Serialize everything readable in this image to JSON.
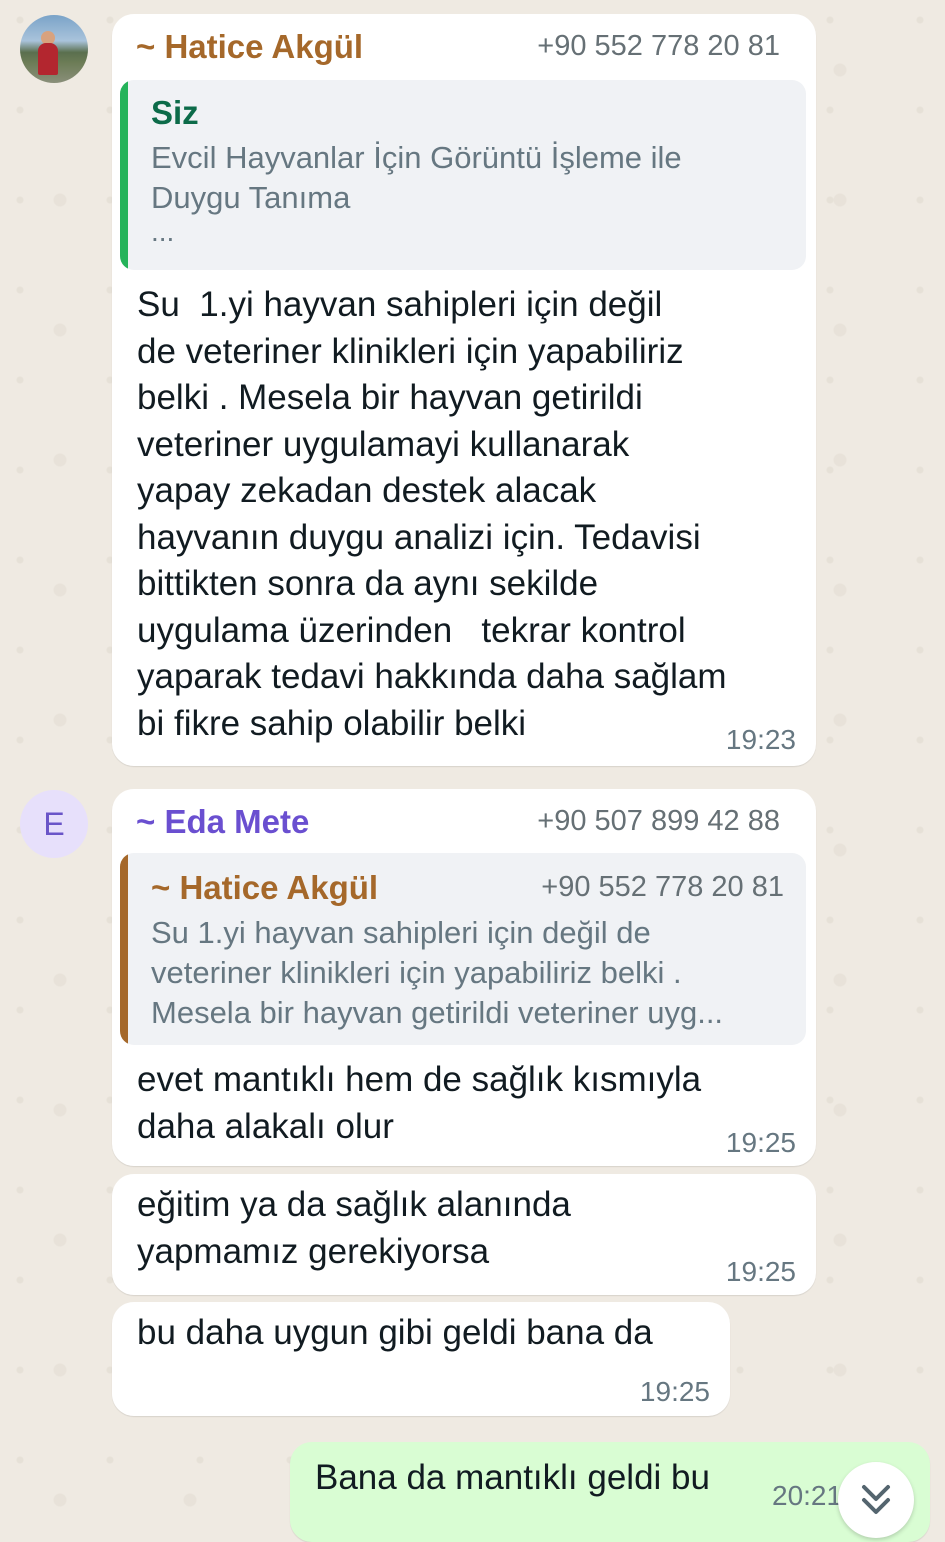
{
  "messages": [
    {
      "sender": "~ Hatice Akgül",
      "phone": "+90 552 778 20 81",
      "quote": {
        "author": "Siz",
        "lines": [
          "Evcil Hayvanlar İçin Görüntü İşleme ile",
          "Duygu Tanıma",
          "..."
        ]
      },
      "text": "Su  1.yi hayvan sahipleri için değil\nde veteriner klinikleri için yapabiliriz\nbelki . Mesela bir hayvan getirildi\nveteriner uygulamayi kullanarak\nyapay zekadan destek alacak\nhayvanın duygu analizi için. Tedavisi\nbittikten sonra da aynı sekilde\nuygulama üzerinden   tekrar kontrol\nyaparak tedavi hakkında daha sağlam\nbi fikre sahip olabilir belki",
      "time": "19:23"
    },
    {
      "avatar_letter": "E",
      "sender": "~ Eda Mete",
      "phone": "+90 507 899 42 88",
      "quote": {
        "author": "~ Hatice Akgül",
        "phone": "+90 552 778 20 81",
        "lines": [
          "Su  1.yi hayvan sahipleri için değil de",
          "veteriner klinikleri için yapabiliriz belki .",
          "Mesela bir hayvan getirildi veteriner uyg..."
        ]
      },
      "text": "evet mantıklı hem de sağlık kısmıyla\ndaha alakalı olur",
      "time": "19:25"
    },
    {
      "text": "eğitim ya da sağlık alanında\nyapmamız gerekiyorsa",
      "time": "19:25"
    },
    {
      "text": "bu daha uygun gibi geldi bana da",
      "time": "19:25"
    },
    {
      "outgoing": true,
      "text": "Bana da mantıklı geldi bu",
      "time": "20:21"
    }
  ],
  "colors": {
    "hatice": "#a5682a",
    "eda": "#6a4fd0",
    "siz_bar": "#25b35a",
    "siz_name": "#0c6b49",
    "quote_text": "#667781",
    "outgoing_bubble": "#d9fdd3"
  },
  "icons": {
    "scroll_down": "double-chevron-down-icon"
  }
}
